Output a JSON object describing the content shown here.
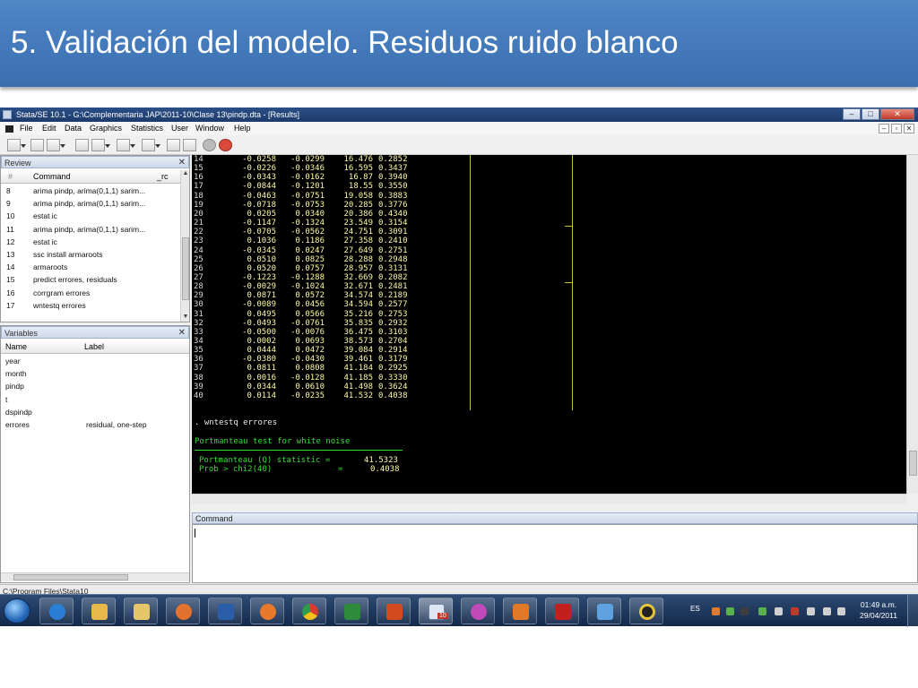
{
  "slide": {
    "title": "5. Validación del modelo. Residuos ruido blanco"
  },
  "window": {
    "title": "Stata/SE 10.1 - G:\\Complementaria JAP\\2011-10\\Clase 13\\pindp.dta - [Results]",
    "buttons": [
      "minimize",
      "restore",
      "close"
    ]
  },
  "menu": [
    "File",
    "Edit",
    "Data",
    "Graphics",
    "Statistics",
    "User",
    "Window",
    "Help"
  ],
  "toolbar_icons": [
    "open-icon",
    "save-icon",
    "print-icon",
    "log-icon",
    "viewer-icon",
    "graph-icon",
    "do-file-editor-icon",
    "data-editor-icon",
    "data-browser-icon",
    "break-icon",
    "stop-icon"
  ],
  "review": {
    "title": "Review",
    "col_hash": "#",
    "col_command": "Command",
    "col_rc": "_rc",
    "rows": [
      {
        "n": "8",
        "cmd": "arima pindp, arima(0,1,1) sarim..."
      },
      {
        "n": "9",
        "cmd": "arima pindp, arima(0,1,1) sarim..."
      },
      {
        "n": "10",
        "cmd": "estat ic"
      },
      {
        "n": "11",
        "cmd": "arima pindp, arima(0,1,1) sarim..."
      },
      {
        "n": "12",
        "cmd": "estat ic"
      },
      {
        "n": "13",
        "cmd": "ssc install armaroots"
      },
      {
        "n": "14",
        "cmd": "armaroots"
      },
      {
        "n": "15",
        "cmd": "predict errores, residuals"
      },
      {
        "n": "16",
        "cmd": "corrgram errores"
      },
      {
        "n": "17",
        "cmd": "wntestq errores"
      }
    ]
  },
  "variables": {
    "title": "Variables",
    "col_name": "Name",
    "col_label": "Label",
    "rows": [
      {
        "name": "year",
        "label": ""
      },
      {
        "name": "month",
        "label": ""
      },
      {
        "name": "pindp",
        "label": ""
      },
      {
        "name": "t",
        "label": ""
      },
      {
        "name": "dspindp",
        "label": ""
      },
      {
        "name": "errores",
        "label": "residual, one-step"
      }
    ]
  },
  "results": {
    "rows": [
      {
        "lag": "14",
        "ac": "-0.0258",
        "pac": "-0.0299",
        "q": "16.476",
        "p": "0.2852"
      },
      {
        "lag": "15",
        "ac": "-0.0226",
        "pac": "-0.0346",
        "q": "16.595",
        "p": "0.3437"
      },
      {
        "lag": "16",
        "ac": "-0.0343",
        "pac": "-0.0162",
        "q": "16.87",
        "p": "0.3940"
      },
      {
        "lag": "17",
        "ac": "-0.0844",
        "pac": "-0.1201",
        "q": "18.55",
        "p": "0.3550"
      },
      {
        "lag": "18",
        "ac": "-0.0463",
        "pac": "-0.0751",
        "q": "19.058",
        "p": "0.3883"
      },
      {
        "lag": "19",
        "ac": "-0.0718",
        "pac": "-0.0753",
        "q": "20.285",
        "p": "0.3776"
      },
      {
        "lag": "20",
        "ac": "0.0205",
        "pac": "0.0340",
        "q": "20.386",
        "p": "0.4340"
      },
      {
        "lag": "21",
        "ac": "-0.1147",
        "pac": "-0.1324",
        "q": "23.549",
        "p": "0.3154"
      },
      {
        "lag": "22",
        "ac": "-0.0705",
        "pac": "-0.0562",
        "q": "24.751",
        "p": "0.3091"
      },
      {
        "lag": "23",
        "ac": "0.1036",
        "pac": "0.1186",
        "q": "27.358",
        "p": "0.2410"
      },
      {
        "lag": "24",
        "ac": "-0.0345",
        "pac": "0.0247",
        "q": "27.649",
        "p": "0.2751"
      },
      {
        "lag": "25",
        "ac": "0.0510",
        "pac": "0.0825",
        "q": "28.288",
        "p": "0.2948"
      },
      {
        "lag": "26",
        "ac": "0.0520",
        "pac": "0.0757",
        "q": "28.957",
        "p": "0.3131"
      },
      {
        "lag": "27",
        "ac": "-0.1223",
        "pac": "-0.1288",
        "q": "32.669",
        "p": "0.2082"
      },
      {
        "lag": "28",
        "ac": "-0.0029",
        "pac": "-0.1024",
        "q": "32.671",
        "p": "0.2481"
      },
      {
        "lag": "29",
        "ac": "0.0871",
        "pac": "0.0572",
        "q": "34.574",
        "p": "0.2189"
      },
      {
        "lag": "30",
        "ac": "-0.0089",
        "pac": "0.0456",
        "q": "34.594",
        "p": "0.2577"
      },
      {
        "lag": "31",
        "ac": "0.0495",
        "pac": "0.0566",
        "q": "35.216",
        "p": "0.2753"
      },
      {
        "lag": "32",
        "ac": "-0.0493",
        "pac": "-0.0761",
        "q": "35.835",
        "p": "0.2932"
      },
      {
        "lag": "33",
        "ac": "-0.0500",
        "pac": "-0.0076",
        "q": "36.475",
        "p": "0.3103"
      },
      {
        "lag": "34",
        "ac": "0.0002",
        "pac": "0.0693",
        "q": "38.573",
        "p": "0.2704"
      },
      {
        "lag": "35",
        "ac": "0.0444",
        "pac": "0.0472",
        "q": "39.084",
        "p": "0.2914"
      },
      {
        "lag": "36",
        "ac": "-0.0380",
        "pac": "-0.0430",
        "q": "39.461",
        "p": "0.3179"
      },
      {
        "lag": "37",
        "ac": "0.0811",
        "pac": "0.0808",
        "q": "41.184",
        "p": "0.2925"
      },
      {
        "lag": "38",
        "ac": "0.0016",
        "pac": "-0.0128",
        "q": "41.185",
        "p": "0.3330"
      },
      {
        "lag": "39",
        "ac": "0.0344",
        "pac": "0.0610",
        "q": "41.498",
        "p": "0.3624"
      },
      {
        "lag": "40",
        "ac": "0.0114",
        "pac": "-0.0235",
        "q": "41.532",
        "p": "0.4038"
      }
    ],
    "command_echo": ". wntestq errores",
    "portmanteau_title": "Portmanteau test for white noise",
    "stat_label": "Portmanteau (Q) statistic =",
    "stat_value": "41.5323",
    "prob_label": "Prob > chi2(40)",
    "prob_eq": "=",
    "prob_value": "0.4038"
  },
  "command_panel": {
    "title": "Command",
    "value": ""
  },
  "status_bar": {
    "path": "C:\\Program Files\\Stata10"
  },
  "taskbar": {
    "apps": [
      "start-button",
      "internet-explorer-icon",
      "outlook-icon",
      "file-explorer-icon",
      "media-player-icon",
      "word-icon",
      "firefox-icon",
      "chrome-icon",
      "excel-icon",
      "powerpoint-icon",
      "stata-icon",
      "network-icon",
      "matlab-icon",
      "acrobat-icon",
      "paint-icon",
      "webcam-icon"
    ],
    "stata_badge": "10",
    "language": "ES",
    "time": "01:49 a.m.",
    "date": "29/04/2011"
  }
}
